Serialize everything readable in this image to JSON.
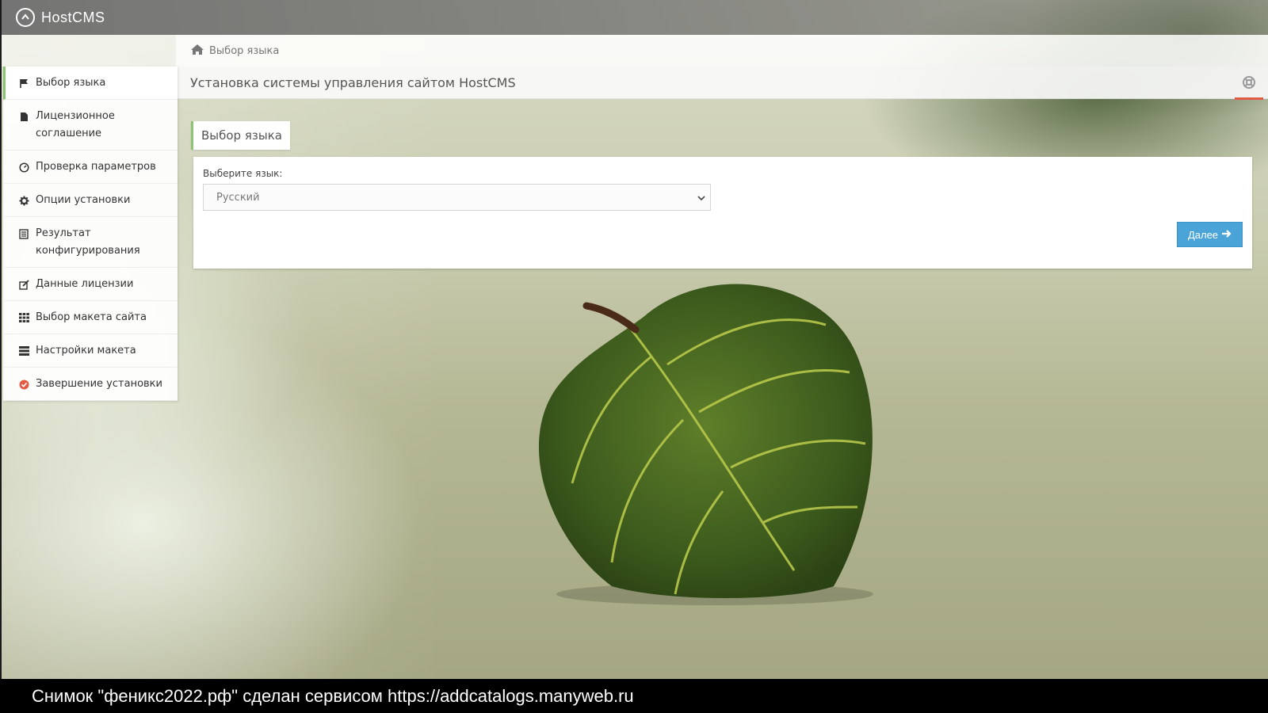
{
  "app": {
    "brand": "HostCMS"
  },
  "breadcrumb": {
    "icon": "home-icon",
    "text": "Выбор языка"
  },
  "header": {
    "title": "Установка системы управления сайтом HostCMS"
  },
  "sidebar": {
    "items": [
      {
        "label": "Выбор языка",
        "icon": "flag-icon",
        "active": true
      },
      {
        "label": "Лицензионное соглашение",
        "icon": "file-icon",
        "active": false
      },
      {
        "label": "Проверка параметров",
        "icon": "gauge-icon",
        "active": false
      },
      {
        "label": "Опции установки",
        "icon": "gear-icon",
        "active": false
      },
      {
        "label": "Результат конфигурирования",
        "icon": "list-icon",
        "active": false
      },
      {
        "label": "Данные лицензии",
        "icon": "edit-icon",
        "active": false
      },
      {
        "label": "Выбор макета сайта",
        "icon": "grid-icon",
        "active": false
      },
      {
        "label": "Настройки макета",
        "icon": "server-icon",
        "active": false
      },
      {
        "label": "Завершение установки",
        "icon": "check-circle-icon",
        "active": false
      }
    ]
  },
  "main": {
    "section_title": "Выбор языка",
    "language_label": "Выберите язык:",
    "language_value": "Русский",
    "next_label": "Далее"
  },
  "caption": {
    "text": "Снимок \"феникс2022.рф\" сделан сервисом https://addcatalogs.manyweb.ru"
  },
  "colors": {
    "accent_green": "#8cc474",
    "button_blue": "#4aa4d8",
    "help_red": "#e25b45"
  }
}
